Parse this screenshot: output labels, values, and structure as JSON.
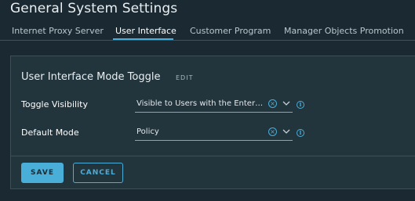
{
  "page": {
    "title": "General System Settings"
  },
  "tabs": [
    {
      "label": "Internet Proxy Server",
      "active": false
    },
    {
      "label": "User Interface",
      "active": true
    },
    {
      "label": "Customer Program",
      "active": false
    },
    {
      "label": "Manager Objects Promotion",
      "active": false
    }
  ],
  "card": {
    "title": "User Interface Mode Toggle",
    "edit_label": "EDIT",
    "fields": [
      {
        "label": "Toggle Visibility",
        "value": "Visible to Users with the Enterprise Admin Role"
      },
      {
        "label": "Default Mode",
        "value": "Policy"
      }
    ],
    "save_label": "SAVE",
    "cancel_label": "CANCEL"
  },
  "icons": {
    "clear": "clear-circle-icon",
    "dropdown": "chevron-down-icon",
    "info": "info-icon"
  },
  "colors": {
    "accent": "#49afd9",
    "background": "#1b2a32",
    "card": "#22343c"
  }
}
